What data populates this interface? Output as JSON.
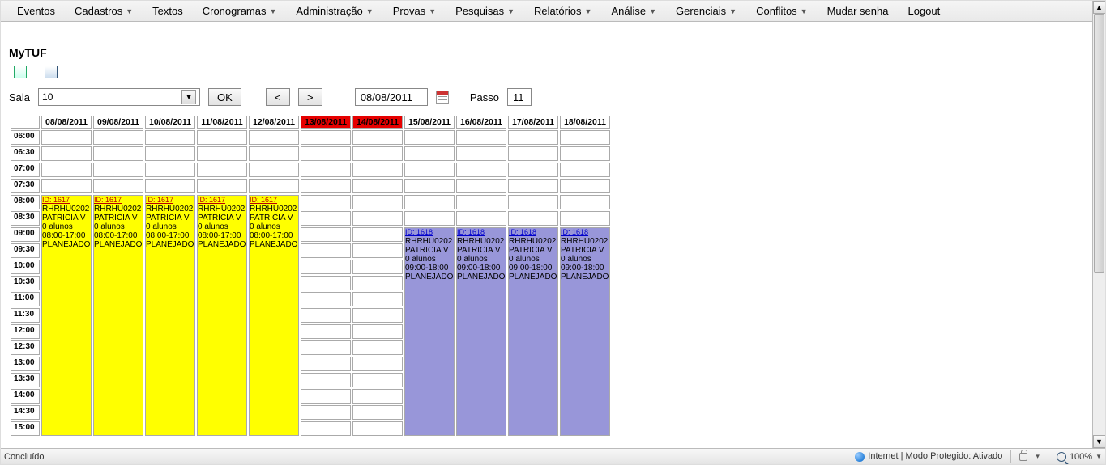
{
  "menu": [
    "Eventos",
    "Cadastros",
    "Textos",
    "Cronogramas",
    "Administração",
    "Provas",
    "Pesquisas",
    "Relatórios",
    "Análise",
    "Gerenciais",
    "Conflitos",
    "Mudar senha",
    "Logout"
  ],
  "menu_has_dd": [
    false,
    true,
    false,
    true,
    true,
    true,
    true,
    true,
    true,
    true,
    true,
    false,
    false
  ],
  "title": "MyTUF",
  "controls": {
    "sala_label": "Sala",
    "sala_value": "10",
    "ok": "OK",
    "prev": "<",
    "next": ">",
    "date": "08/08/2011",
    "passo_label": "Passo",
    "passo_value": "11"
  },
  "dates": [
    "08/08/2011",
    "09/08/2011",
    "10/08/2011",
    "11/08/2011",
    "12/08/2011",
    "13/08/2011",
    "14/08/2011",
    "15/08/2011",
    "16/08/2011",
    "17/08/2011",
    "18/08/2011"
  ],
  "weekend_idx": [
    5,
    6
  ],
  "times": [
    "06:00",
    "06:30",
    "07:00",
    "07:30",
    "08:00",
    "08:30",
    "09:00",
    "09:30",
    "10:00",
    "10:30",
    "11:00",
    "11:30",
    "12:00",
    "12:30",
    "13:00",
    "13:30",
    "14:00",
    "14:30",
    "15:00"
  ],
  "yellow": {
    "cols": [
      0,
      1,
      2,
      3,
      4
    ],
    "start": "08:00",
    "span": 15,
    "id": "ID: 1617",
    "lines": [
      "RHRHU0202",
      "PATRICIA V",
      "0 alunos",
      "08:00-17:00",
      "PLANEJADO"
    ]
  },
  "purple": {
    "cols": [
      7,
      8,
      9,
      10
    ],
    "start": "09:00",
    "span": 13,
    "id": "ID: 1618",
    "lines": [
      "RHRHU0202",
      "PATRICIA V",
      "0 alunos",
      "09:00-18:00",
      "PLANEJADO"
    ]
  },
  "status": {
    "left": "Concluído",
    "mode": "Internet | Modo Protegido: Ativado",
    "zoom": "100%"
  }
}
